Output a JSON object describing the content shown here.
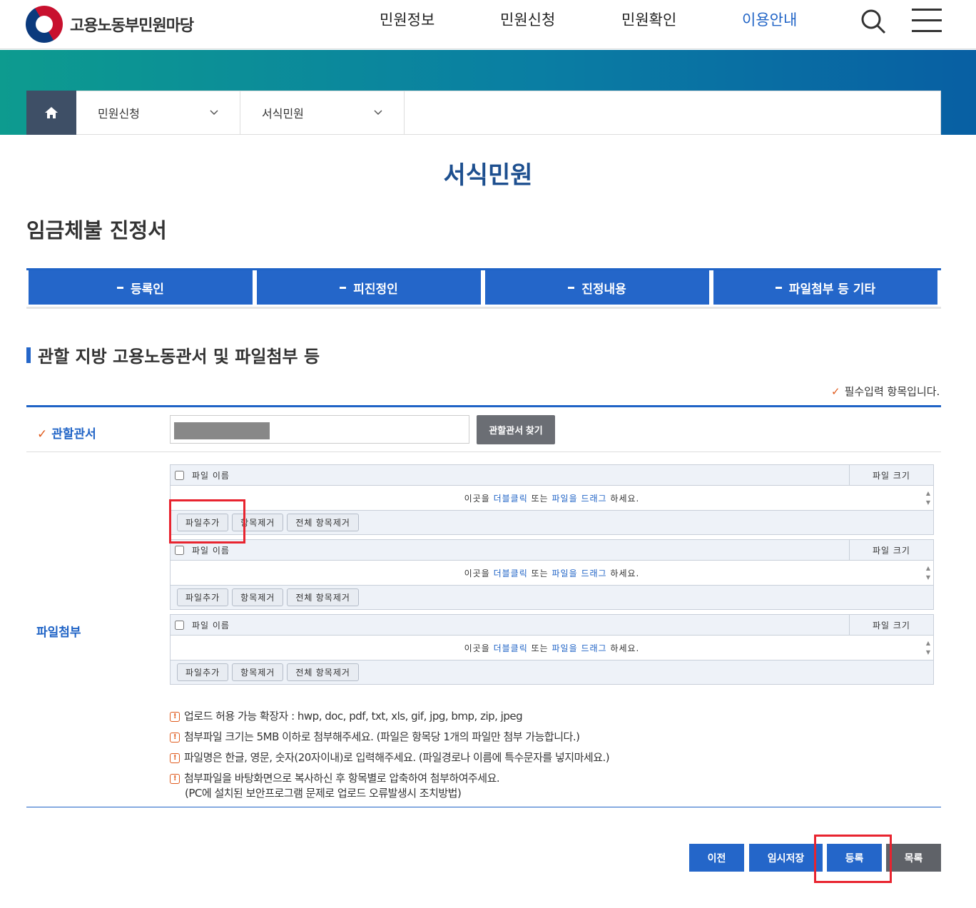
{
  "header": {
    "logo_text": "고용노동부민원마당",
    "nav": [
      "민원정보",
      "민원신청",
      "민원확인",
      "이용안내"
    ],
    "active_nav": "이용안내",
    "icons": [
      "search-icon",
      "menu-icon"
    ]
  },
  "breadcrumb": {
    "home_icon": "home-icon",
    "items": [
      "민원신청",
      "서식민원"
    ]
  },
  "page_title": "서식민원",
  "form_title": "임금체불 진정서",
  "tabs": [
    "등록인",
    "피진정인",
    "진정내용",
    "파일첨부 등 기타"
  ],
  "section_title": "관할 지방 고용노동관서 및 파일첨부 등",
  "required_note": "필수입력 항목입니다.",
  "jurisdiction": {
    "label": "관할관서",
    "find_button": "관할관서 찾기"
  },
  "attachments": {
    "label": "파일첨부",
    "header_name": "파일 이름",
    "header_size": "파일 크기",
    "drop_text_1": "이곳을",
    "drop_link_1": "더블클릭",
    "drop_text_2": "또는",
    "drop_link_2": "파일을 드래그",
    "drop_text_3": "하세요.",
    "btn_add": "파일추가",
    "btn_remove": "항목제거",
    "btn_remove_all": "전체 항목제거"
  },
  "notes": [
    "업로드 허용 가능 확장자 : hwp, doc, pdf, txt, xls, gif, jpg, bmp, zip, jpeg",
    "첨부파일 크기는 5MB 이하로 첨부해주세요. (파일은 항목당 1개의 파일만 첨부 가능합니다.)",
    "파일명은 한글, 영문, 숫자(20자이내)로 입력해주세요. (파일경로나 이름에 특수문자를 넣지마세요.)",
    "첨부파일을 바탕화면으로 복사하신 후 항목별로 압축하여 첨부하여주세요."
  ],
  "note_sub": "(PC에 설치된 보안프로그램 문제로 업로드 오류발생시 조치방법)",
  "actions": [
    "이전",
    "임시저장",
    "등록",
    "목록"
  ],
  "colors": {
    "primary": "#2466c9",
    "title": "#1d4f8f",
    "highlight": "#e8242f"
  }
}
